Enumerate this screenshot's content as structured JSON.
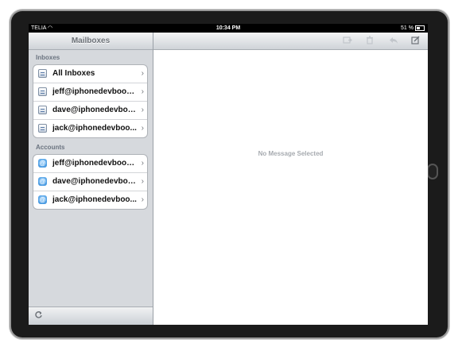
{
  "status_bar": {
    "carrier": "TELIA",
    "time": "10:34 PM",
    "battery": "51 %"
  },
  "sidebar": {
    "title": "Mailboxes",
    "inboxes_label": "Inboxes",
    "inboxes": [
      {
        "label": "All Inboxes",
        "icon": "inbox-icon"
      },
      {
        "label": "jeff@iphonedevbook....",
        "icon": "inbox-icon"
      },
      {
        "label": "dave@iphonedevboo...",
        "icon": "inbox-icon"
      },
      {
        "label": "jack@iphonedevboo...",
        "icon": "inbox-icon"
      }
    ],
    "accounts_label": "Accounts",
    "accounts": [
      {
        "label": "jeff@iphonedevbook....",
        "icon": "account-icon"
      },
      {
        "label": "dave@iphonedevboo...",
        "icon": "account-icon"
      },
      {
        "label": "jack@iphonedevboo...",
        "icon": "account-icon"
      }
    ],
    "chevron": "›",
    "refresh_icon": "refresh-icon"
  },
  "detail": {
    "empty_message": "No Message Selected",
    "toolbar_icons": [
      "move-folder-icon",
      "trash-icon",
      "reply-icon",
      "compose-icon"
    ]
  }
}
